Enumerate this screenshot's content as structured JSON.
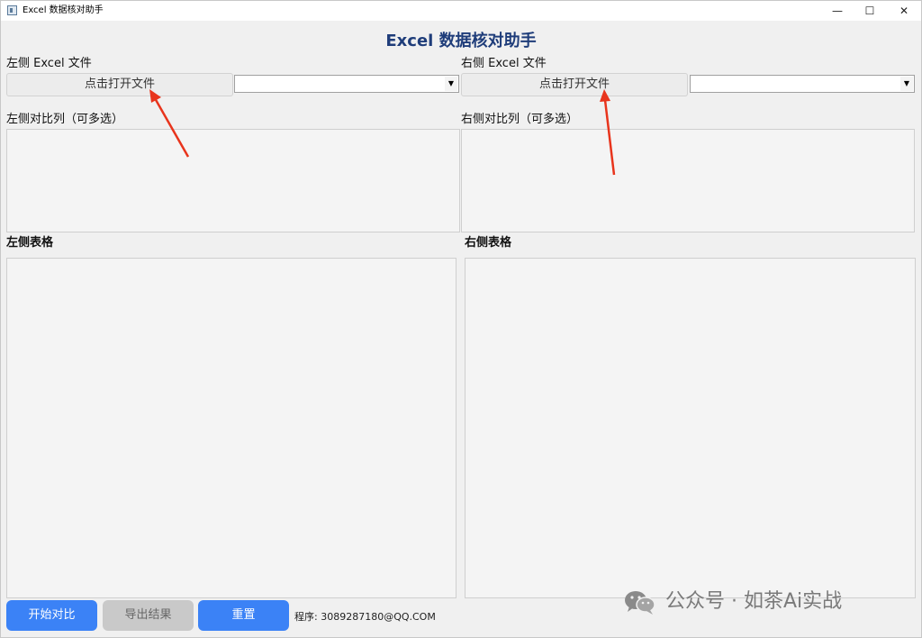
{
  "window": {
    "title": "Excel 数据核对助手",
    "minimize_glyph": "—",
    "maximize_glyph": "☐",
    "close_glyph": "✕"
  },
  "app": {
    "title": "Excel 数据核对助手"
  },
  "left": {
    "file_label": "左侧 Excel 文件",
    "open_button": "点击打开文件",
    "sheet_select_value": "",
    "compare_label": "左侧对比列（可多选）",
    "table_label": "左侧表格"
  },
  "right": {
    "file_label": "右侧 Excel 文件",
    "open_button": "点击打开文件",
    "sheet_select_value": "",
    "compare_label": "右侧对比列（可多选）",
    "table_label": "右侧表格"
  },
  "actions": {
    "start_compare": "开始对比",
    "export_results": "导出结果",
    "reset": "重置"
  },
  "footer": {
    "program": "程序: 3089287180@QQ.COM"
  },
  "watermark": {
    "text": "公众号 · 如茶Ai实战"
  },
  "icons": {
    "combo_arrow": "▼",
    "wechat": "wechat-icon",
    "annotation": "red-arrow-icon"
  },
  "colors": {
    "title_blue": "#1f3d7a",
    "accent_blue": "#3b82f6",
    "annotation_red": "#e8341c",
    "disabled_gray": "#c9c9c9"
  }
}
